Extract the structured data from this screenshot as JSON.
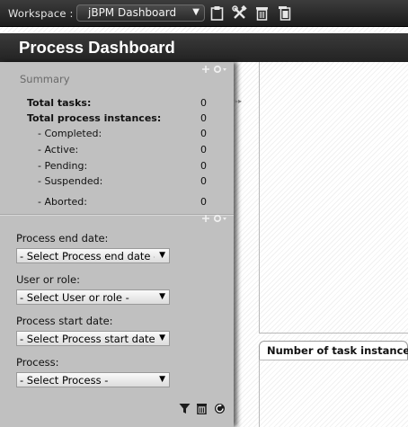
{
  "workspace": {
    "label": "Workspace :",
    "selected": "jBPM Dashboard",
    "toolbar_icons": [
      "clipboard-icon",
      "tools-icon",
      "trash-icon",
      "copy-icon"
    ]
  },
  "page": {
    "title": "Process Dashboard"
  },
  "summary": {
    "title": "Summary",
    "rows": [
      {
        "label": "Total tasks:",
        "value": "0"
      },
      {
        "label": "Total process instances:",
        "value": "0"
      },
      {
        "label": "- Completed:",
        "value": "0"
      },
      {
        "label": "- Active:",
        "value": "0"
      },
      {
        "label": "- Pending:",
        "value": "0"
      },
      {
        "label": "- Suspended:",
        "value": "0"
      },
      {
        "label": "- Aborted:",
        "value": "0"
      }
    ]
  },
  "filters": [
    {
      "label": "Process end date:",
      "value": "- Select Process end date -"
    },
    {
      "label": "User or role:",
      "value": "- Select User or role -"
    },
    {
      "label": "Process start date:",
      "value": "- Select Process start date -"
    },
    {
      "label": "Process:",
      "value": "- Select Process -"
    }
  ],
  "filter_actions": [
    "filter-icon",
    "trash-icon",
    "refresh-icon"
  ],
  "right_panel": {
    "tab_title": "Number of task instances"
  },
  "colors": {
    "topbar": "#2a2a2a",
    "panel": "#c0c0c0",
    "title_text": "#ffffff"
  }
}
